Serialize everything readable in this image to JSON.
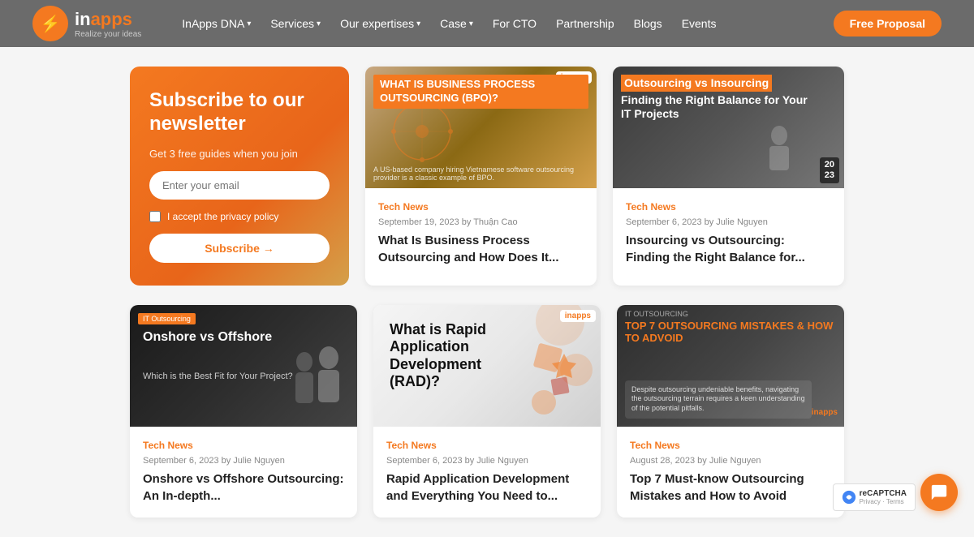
{
  "header": {
    "logo_icon": "⚡",
    "logo_text_in": "in",
    "logo_text_apps": "apps",
    "logo_tagline": "Realize your ideas",
    "nav": {
      "dna": "InApps DNA",
      "services": "Services",
      "expertises": "Our expertises",
      "case": "Case",
      "cto": "For CTO",
      "partnership": "Partnership",
      "blogs": "Blogs",
      "events": "Events",
      "cta": "Free Proposal"
    }
  },
  "newsletter": {
    "title": "Subscribe to our newsletter",
    "subtitle": "Get 3 free guides when you join",
    "email_placeholder": "Enter your email",
    "privacy_label": "I accept the privacy policy",
    "subscribe_label": "Subscribe →"
  },
  "cards": [
    {
      "category": "Tech News",
      "date": "September 19, 2023 by Thuận Cao",
      "title": "What Is Business Process Outsourcing and How Does It...",
      "img_type": "bpo",
      "img_text": "WHAT IS BUSINESS PROCESS OUTSOURCING (BPO)?"
    },
    {
      "category": "Tech News",
      "date": "September 6, 2023 by Julie Nguyen",
      "title": "Insourcing vs Outsourcing: Finding the Right Balance for...",
      "img_type": "insource",
      "img_text": "Outsourcing vs Insourcing Finding the Right Balance for Your IT Projects",
      "year": "20\n23"
    }
  ],
  "cards2": [
    {
      "category": "Tech News",
      "date": "September 6, 2023 by Julie Nguyen",
      "title": "Onshore vs Offshore Outsourcing: An In-depth...",
      "img_type": "onshore",
      "badge": "IT Outsourcing",
      "img_title": "Onshore vs Offshore",
      "img_sub": "Which is the Best Fit for Your Project?"
    },
    {
      "category": "Tech News",
      "date": "September 6, 2023 by Julie Nguyen",
      "title": "Rapid Application Development and Everything You Need to...",
      "img_type": "rad",
      "img_title": "What is Rapid Application Development (RAD)?"
    },
    {
      "category": "Tech News",
      "date": "August 28, 2023 by Julie Nguyen",
      "title": "Top 7 Must-know Outsourcing Mistakes and How to Avoid",
      "img_type": "mistakes",
      "img_title": "TOP 7 OUTSOURCING MISTAKES & HOW TO ADVOID"
    }
  ],
  "chat": {
    "icon": "💬"
  }
}
